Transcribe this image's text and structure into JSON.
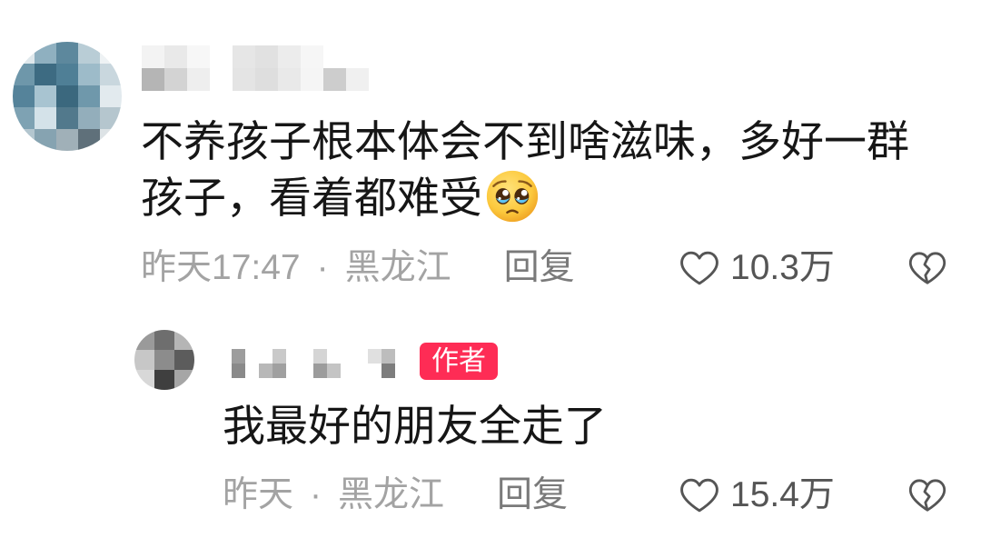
{
  "comment": {
    "text": "不养孩子根本体会不到啥滋味，多好一群孩子，看着都难受",
    "emoji_icon": "pleading-face-emoji",
    "time": "昨天17:47",
    "separator": "·",
    "location": "黑龙江",
    "reply_label": "回复",
    "like_count": "10.3万",
    "like_icon": "heart-outline-icon",
    "dislike_icon": "broken-heart-icon"
  },
  "reply": {
    "author_badge": "作者",
    "text": "我最好的朋友全走了",
    "time": "昨天",
    "separator": "·",
    "location": "黑龙江",
    "reply_label": "回复",
    "like_count": "15.4万",
    "like_icon": "heart-outline-icon",
    "dislike_icon": "broken-heart-icon"
  },
  "colors": {
    "text": "#161616",
    "meta": "#a3a3a3",
    "action": "#7a7a7a",
    "count": "#555555",
    "icon": "#555555",
    "badge_bg": "#fe2c55",
    "badge_text": "#ffffff"
  }
}
